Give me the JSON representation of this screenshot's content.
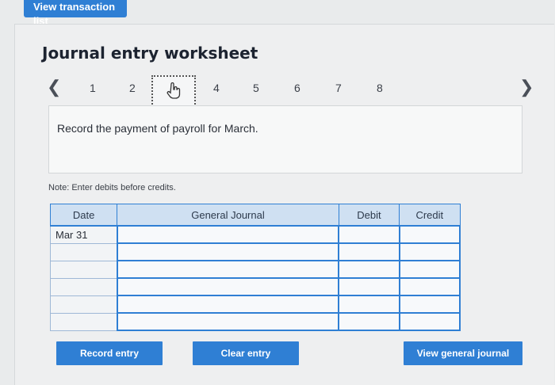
{
  "top": {
    "view_transaction_list": "View transaction list"
  },
  "worksheet": {
    "title": "Journal entry worksheet",
    "pages": [
      "1",
      "2",
      "",
      "4",
      "5",
      "6",
      "7",
      "8"
    ],
    "instruction": "Record the payment of payroll for March.",
    "note": "Note: Enter debits before credits."
  },
  "table": {
    "headers": {
      "date": "Date",
      "general_journal": "General Journal",
      "debit": "Debit",
      "credit": "Credit"
    },
    "rows": [
      {
        "date": "Mar 31",
        "account": "",
        "debit": "",
        "credit": ""
      },
      {
        "date": "",
        "account": "",
        "debit": "",
        "credit": ""
      },
      {
        "date": "",
        "account": "",
        "debit": "",
        "credit": ""
      },
      {
        "date": "",
        "account": "",
        "debit": "",
        "credit": ""
      },
      {
        "date": "",
        "account": "",
        "debit": "",
        "credit": ""
      },
      {
        "date": "",
        "account": "",
        "debit": "",
        "credit": ""
      }
    ]
  },
  "buttons": {
    "record_entry": "Record entry",
    "clear_entry": "Clear entry",
    "view_general_journal": "View general journal"
  },
  "colors": {
    "accent": "#2f7fd4",
    "header_bg": "#cfe0f2"
  }
}
